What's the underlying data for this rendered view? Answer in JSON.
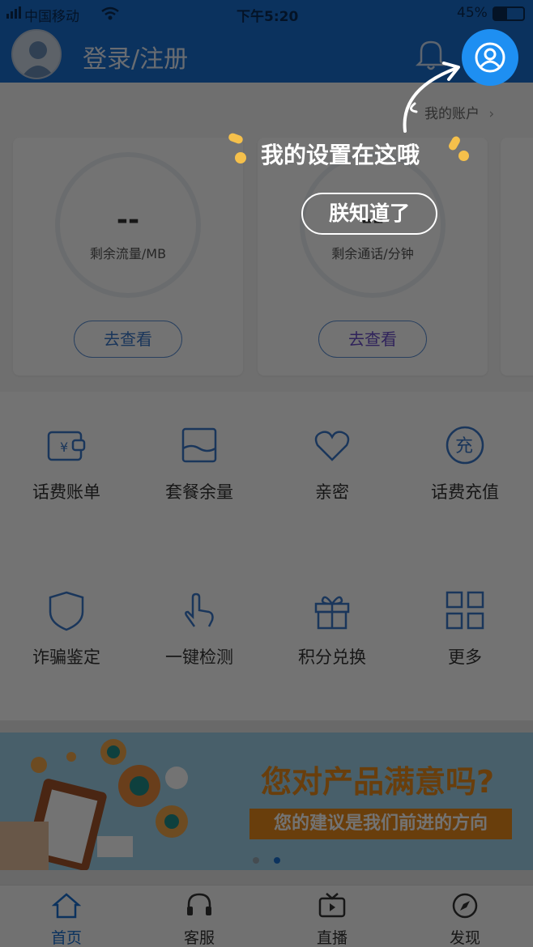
{
  "status_bar": {
    "carrier": "中国移动",
    "time": "下午5:20",
    "battery": "45%"
  },
  "header": {
    "login_label": "登录/注册"
  },
  "account": {
    "link_label": "我的账户"
  },
  "cards": [
    {
      "value": "--",
      "unit_label": "剩余流量/MB",
      "button": "去查看"
    },
    {
      "value": "--",
      "unit_label": "剩余通话/分钟",
      "button": "去查看"
    }
  ],
  "grid": [
    {
      "label": "话费账单",
      "icon": "wallet-icon"
    },
    {
      "label": "套餐余量",
      "icon": "package-icon"
    },
    {
      "label": "亲密",
      "icon": "heart-icon"
    },
    {
      "label": "话费充值",
      "icon": "recharge-icon"
    },
    {
      "label": "诈骗鉴定",
      "icon": "shield-icon"
    },
    {
      "label": "一键检测",
      "icon": "tap-icon"
    },
    {
      "label": "积分兑换",
      "icon": "gift-icon"
    },
    {
      "label": "更多",
      "icon": "more-grid-icon"
    }
  ],
  "banner": {
    "title": "您对产品满意吗?",
    "subtitle": "您的建议是我们前进的方向",
    "page_count": 2,
    "active_page": 2
  },
  "tabs": [
    {
      "label": "首页",
      "icon": "home-icon",
      "active": true
    },
    {
      "label": "客服",
      "icon": "headset-icon",
      "active": false
    },
    {
      "label": "直播",
      "icon": "tv-icon",
      "active": false
    },
    {
      "label": "发现",
      "icon": "compass-icon",
      "active": false
    }
  ],
  "guide": {
    "hint": "我的设置在这哦",
    "confirm": "朕知道了"
  },
  "colors": {
    "primary": "#1a6fd0",
    "accent_blue": "#1e8ff2",
    "banner_orange": "#e88a1c",
    "dot_yellow": "#f5c04b"
  }
}
